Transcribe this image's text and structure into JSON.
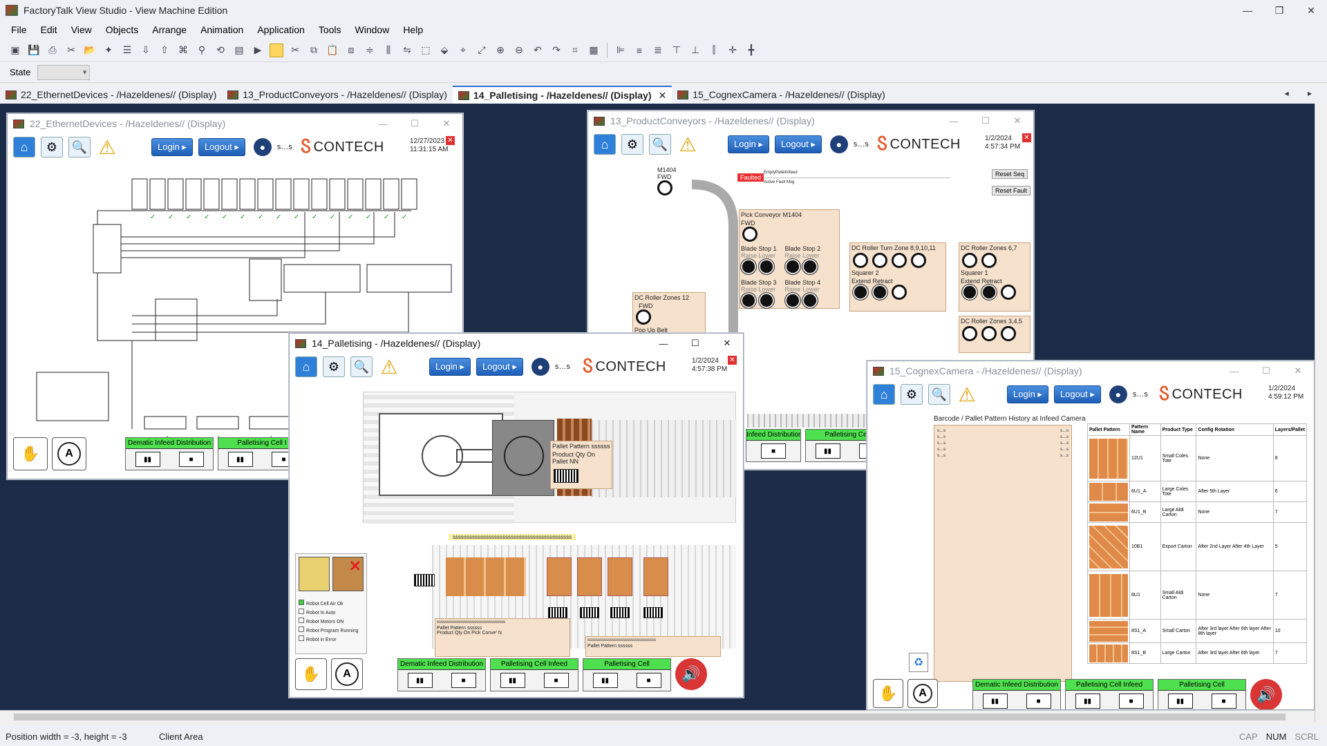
{
  "app": {
    "title": "FactoryTalk View Studio - View Machine Edition",
    "minimize": "—",
    "restore": "❐",
    "close": "✕"
  },
  "menu": [
    "File",
    "Edit",
    "View",
    "Objects",
    "Arrange",
    "Animation",
    "Application",
    "Tools",
    "Window",
    "Help"
  ],
  "state_bar": {
    "label": "State",
    "value": ""
  },
  "doc_tabs": [
    {
      "label": "22_EthernetDevices - /Hazeldenes// (Display)",
      "active": false
    },
    {
      "label": "13_ProductConveyors - /Hazeldenes// (Display)",
      "active": false
    },
    {
      "label": "14_Palletising - /Hazeldenes// (Display)",
      "active": true,
      "close": "✕"
    },
    {
      "label": "15_CognexCamera - /Hazeldenes// (Display)",
      "active": false
    }
  ],
  "tab_nav": "◂ ▸",
  "hmi": {
    "login": "Login ▸",
    "logout": "Logout ▸",
    "user": "s…s",
    "brand": "CONTECH",
    "brand_mark": "Ⴝ",
    "close_x": "✕",
    "hand": "✋",
    "auto": "A",
    "speaker": "🔊",
    "home": "⌂",
    "gear": "⚙",
    "search": "🔍",
    "warn": "⚠",
    "user_icon": "●"
  },
  "win_ethernet": {
    "title": "22_EthernetDevices - /Hazeldenes// (Display)",
    "date": "12/27/2023",
    "time": "11:31:15 AM",
    "zones": [
      {
        "label": "Dematic Infeed Distribution"
      },
      {
        "label": "Palletising Cell I"
      }
    ]
  },
  "win_conveyors": {
    "title": "13_ProductConveyors - /Hazeldenes// (Display)",
    "date": "1/2/2024",
    "time": "4:57:34 PM",
    "motor_label": "M1404",
    "fwd": "FWD",
    "faulted": "Faulted",
    "empty_pallet": "EmptyPalletInfeed",
    "active_fault": "Active Fault Msg",
    "reset_seq": "Reset Seq",
    "reset_fault": "Reset Fault",
    "pick_conveyor": "Pick Conveyor M1404",
    "blade1": "Blade Stop 1",
    "blade2": "Blade Stop 2",
    "blade3": "Blade Stop 3",
    "blade4": "Blade Stop 4",
    "raise": "Raise",
    "lower": "Lower",
    "dc12": "DC Roller Zones 12",
    "popup": "Pop Up Belt",
    "turn_zone": "DC Roller Turn Zone 8,9,10,11",
    "squarer2": "Squarer 2",
    "extend": "Extend",
    "retract": "Retract",
    "dc67": "DC Roller Zones 6,7",
    "squarer1": "Squarer 1",
    "dc345": "DC Roller Zones 3,4,5",
    "zones": [
      {
        "label": "Infeed Distribution"
      },
      {
        "label": "Palletising Cell I"
      }
    ]
  },
  "win_palletising": {
    "title": "14_Palletising - /Hazeldenes// (Display)",
    "date": "1/2/2024",
    "time": "4:57:38 PM",
    "pallet_pattern": "Pallet Pattern",
    "pallet_pattern_val": "ssssss",
    "qty_on_pallet": "Product Qty On Pallet",
    "qty_on_pallet_val": "NN",
    "barcode_banner": "sssssssssssssssssssssssssssssssssssssssssss",
    "status_items": [
      {
        "label": "Robot Cell Air Ok",
        "checked": true
      },
      {
        "label": "Robot In Auto",
        "checked": false
      },
      {
        "label": "Robot Motors ON",
        "checked": false
      },
      {
        "label": "Robot Program Running",
        "checked": false
      },
      {
        "label": "Robot in Error",
        "checked": false
      }
    ],
    "left_panel_lines": "sssssssssssssssssssssssssssssssss",
    "pick_conv_qty": "Product Qty On Pick Conve'",
    "pick_conv_qty_val": "N",
    "right_pattern_val": "ssssss",
    "zones": [
      {
        "label": "Dematic Infeed Distribution"
      },
      {
        "label": "Palletising Cell Infeed"
      },
      {
        "label": "Palletising Cell"
      }
    ]
  },
  "win_cognex": {
    "title": "15_CognexCamera - /Hazeldenes// (Display)",
    "date": "1/2/2024",
    "time": "4:59:12 PM",
    "history_title": "Barcode / Pallet Pattern History at Infeed Camera",
    "history_cell": "s…s",
    "recycle": "♻",
    "columns": [
      "Pallet Pattern",
      "Pattern Name",
      "Product Type",
      "Config Rotation",
      "Layers/Pallet"
    ],
    "rows": [
      {
        "name": "12U1",
        "type": "Small Coles Tote",
        "rotation": "None",
        "layers": "8"
      },
      {
        "name": "6U1_A",
        "type": "Large Coles Tote",
        "rotation": "After 5th Layer",
        "layers": "6"
      },
      {
        "name": "6U1_B",
        "type": "Large Aldi Carton",
        "rotation": "None",
        "layers": "7"
      },
      {
        "name": "10B1",
        "type": "Export Carton",
        "rotation": "After 2nd Layer After 4th Layer",
        "layers": "5"
      },
      {
        "name": "8U1",
        "type": "Small Aldi Carton",
        "rotation": "None",
        "layers": "7"
      },
      {
        "name": "8S1_A",
        "type": "Small Carton",
        "rotation": "After 3rd layer After 6th layer After 8th layer",
        "layers": "10"
      },
      {
        "name": "8S1_B",
        "type": "Large Carton",
        "rotation": "After 3rd layer After 6th layer",
        "layers": "7"
      }
    ],
    "zones": [
      {
        "label": "Dematic Infeed Distribution"
      },
      {
        "label": "Palletising Cell Infeed"
      },
      {
        "label": "Palletising Cell"
      }
    ]
  },
  "status": {
    "position": "Position width = -3, height = -3",
    "area": "Client Area",
    "cap": "CAP",
    "num": "NUM",
    "scrl": "SCRL"
  }
}
